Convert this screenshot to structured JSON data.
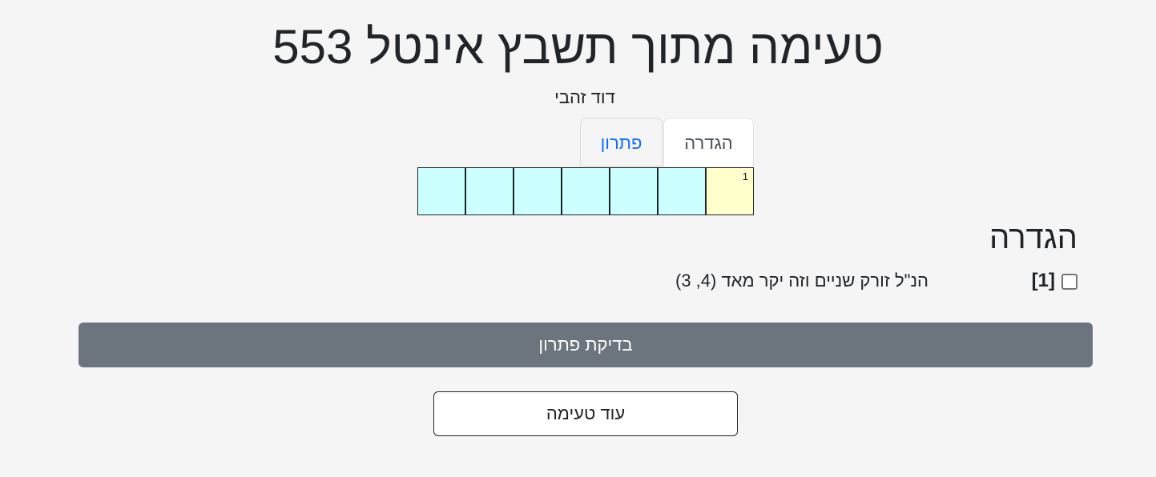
{
  "header": {
    "title": "טעימה מתוך תשבץ אינטל 553",
    "author": "דוד זהבי"
  },
  "tabs": [
    {
      "label": "הגדרה",
      "active": true
    },
    {
      "label": "פתרון",
      "active": false
    }
  ],
  "grid": {
    "cell_count": 7,
    "start_number": "1",
    "colors": {
      "start_cell": "#ffffcc",
      "cell": "#ccffff"
    }
  },
  "clues": {
    "heading": "הגדרה",
    "items": [
      {
        "number": "[1]",
        "text": "הנ\"ל זורק שניים וזה יקר מאד (4, 3)",
        "checked": false
      }
    ]
  },
  "actions": {
    "check_label": "בדיקת פתרון",
    "more_label": "עוד טעימה"
  },
  "colors": {
    "check_button": "#6c757d",
    "active_tab_text": "#0d6efd"
  }
}
